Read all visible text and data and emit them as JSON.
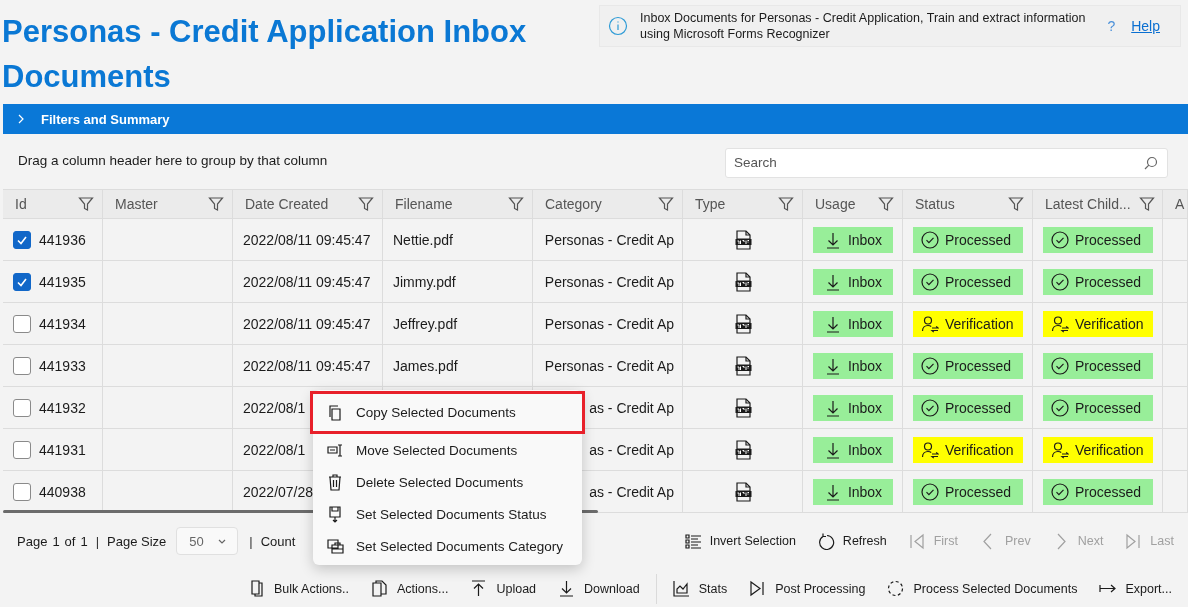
{
  "title": "Personas - Credit Application Inbox Documents",
  "info": {
    "text": "Inbox Documents for Personas - Credit Application, Train and extract information using Microsoft Forms Recognizer",
    "help_mark": "?",
    "help": "Help"
  },
  "filters_bar": {
    "label": "Filters and Summary",
    "expanded": false
  },
  "group_hint": "Drag a column header here to group by that column",
  "search": {
    "placeholder": "Search"
  },
  "columns": [
    {
      "label": "Id",
      "filter": true
    },
    {
      "label": "Master",
      "filter": true
    },
    {
      "label": "Date Created",
      "filter": true
    },
    {
      "label": "Filename",
      "filter": true
    },
    {
      "label": "Category",
      "filter": true
    },
    {
      "label": "Type",
      "filter": true
    },
    {
      "label": "Usage",
      "filter": true
    },
    {
      "label": "Status",
      "filter": true
    },
    {
      "label": "Latest Child...",
      "filter": true
    },
    {
      "label": "A"
    }
  ],
  "rows": [
    {
      "checked": true,
      "id": "441936",
      "date": "2022/08/11 09:45:47",
      "filename": "Nettie.pdf",
      "category": "Personas - Credit Ap",
      "usage": "Inbox",
      "status": {
        "kind": "processed",
        "label": "Processed"
      },
      "latest_child": {
        "kind": "processed",
        "label": "Processed"
      }
    },
    {
      "checked": true,
      "id": "441935",
      "date": "2022/08/11 09:45:47",
      "filename": "Jimmy.pdf",
      "category": "Personas - Credit Ap",
      "usage": "Inbox",
      "status": {
        "kind": "processed",
        "label": "Processed"
      },
      "latest_child": {
        "kind": "processed",
        "label": "Processed"
      }
    },
    {
      "checked": false,
      "id": "441934",
      "date": "2022/08/11 09:45:47",
      "filename": "Jeffrey.pdf",
      "category": "Personas - Credit Ap",
      "usage": "Inbox",
      "status": {
        "kind": "verification",
        "label": "Verification"
      },
      "latest_child": {
        "kind": "verification",
        "label": "Verification"
      }
    },
    {
      "checked": false,
      "id": "441933",
      "date": "2022/08/11 09:45:47",
      "filename": "James.pdf",
      "category": "Personas - Credit Ap",
      "usage": "Inbox",
      "status": {
        "kind": "processed",
        "label": "Processed"
      },
      "latest_child": {
        "kind": "processed",
        "label": "Processed"
      }
    },
    {
      "checked": false,
      "id": "441932",
      "date": "2022/08/1",
      "category": "as - Credit Ap",
      "usage": "Inbox",
      "status": {
        "kind": "processed",
        "label": "Processed"
      },
      "latest_child": {
        "kind": "processed",
        "label": "Processed"
      }
    },
    {
      "checked": false,
      "id": "441931",
      "date": "2022/08/1",
      "category": "as - Credit Ap",
      "usage": "Inbox",
      "status": {
        "kind": "verification",
        "label": "Verification"
      },
      "latest_child": {
        "kind": "verification",
        "label": "Verification"
      }
    },
    {
      "checked": false,
      "id": "440938",
      "date": "2022/07/28",
      "category": "as - Credit Ap",
      "usage": "Inbox",
      "status": {
        "kind": "processed",
        "label": "Processed"
      },
      "latest_child": {
        "kind": "processed",
        "label": "Processed"
      }
    }
  ],
  "context_menu": [
    {
      "label": "Copy Selected Documents",
      "highlighted": true
    },
    {
      "label": "Move Selected Documents",
      "highlighted": false
    },
    {
      "label": "Delete Selected Documents",
      "highlighted": false
    },
    {
      "label": "Set Selected Documents Status",
      "highlighted": false
    },
    {
      "label": "Set Selected Documents Category",
      "highlighted": false
    }
  ],
  "pager": {
    "items": [
      {
        "kind": "text",
        "text": "Page"
      },
      {
        "kind": "text",
        "text": "1"
      },
      {
        "kind": "text",
        "text": "of"
      },
      {
        "kind": "text",
        "text": "1"
      },
      {
        "kind": "sep",
        "text": "|"
      },
      {
        "kind": "text",
        "text": "Page Size"
      },
      {
        "kind": "select",
        "text": "50"
      },
      {
        "kind": "sep",
        "text": "|"
      },
      {
        "kind": "text",
        "text": "Count"
      }
    ],
    "buttons": [
      {
        "label": "Invert Selection",
        "disabled": false
      },
      {
        "label": "Refresh",
        "disabled": false
      },
      {
        "label": "First",
        "disabled": true
      },
      {
        "label": "Prev",
        "disabled": true
      },
      {
        "label": "Next",
        "disabled": true
      },
      {
        "label": "Last",
        "disabled": true
      }
    ]
  },
  "toolbar": [
    "Bulk Actions..",
    "Actions...",
    "Upload",
    "Download",
    "Stats",
    "Post Processing",
    "Process Selected Documents",
    "Export..."
  ]
}
